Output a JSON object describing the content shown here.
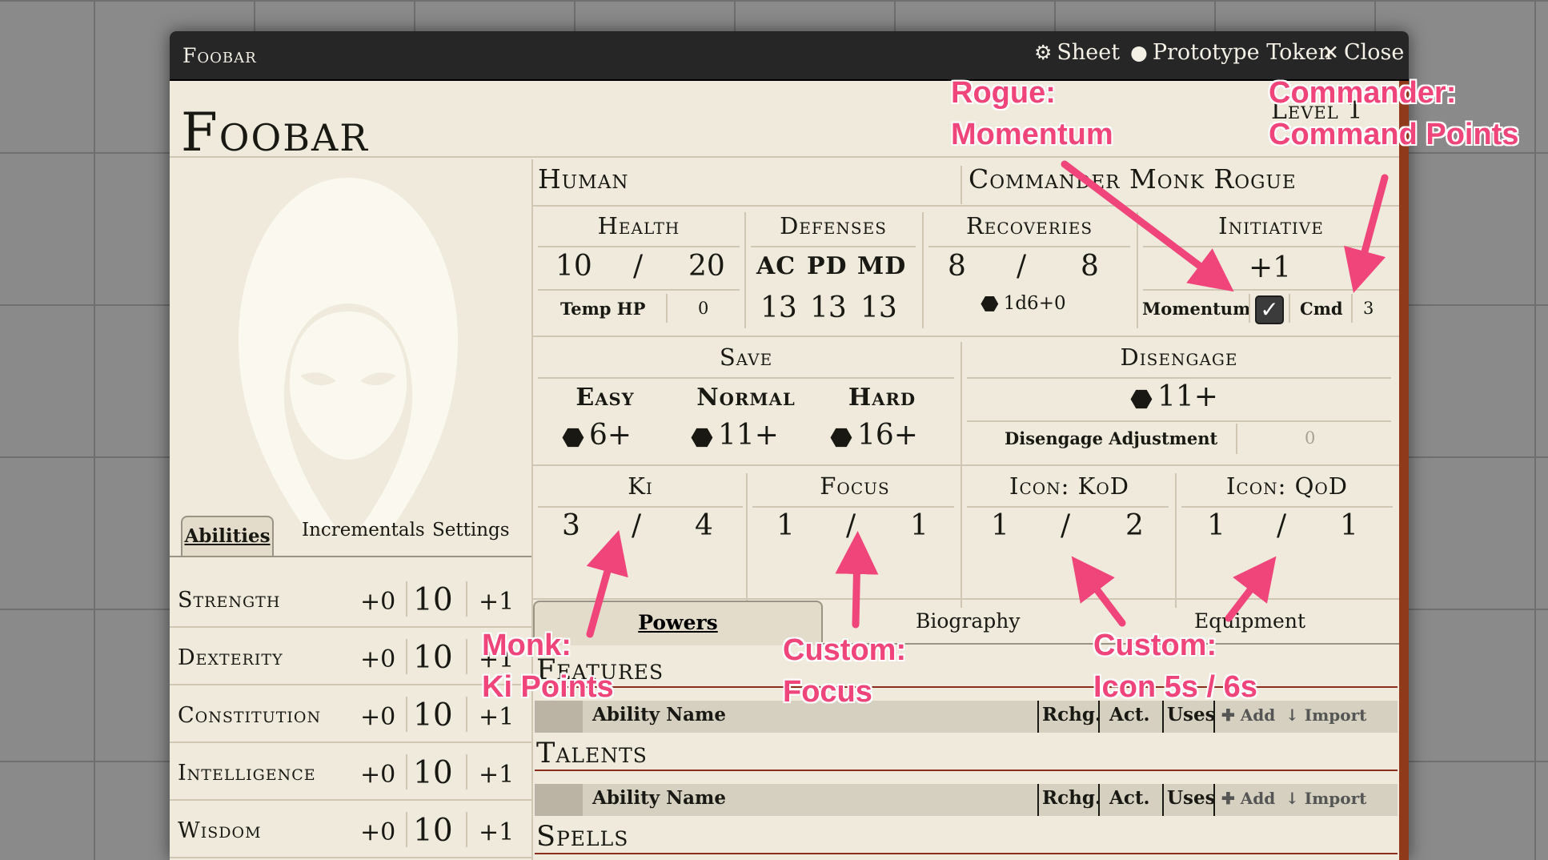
{
  "window": {
    "title": "Foobar",
    "buttons": {
      "sheet": "Sheet",
      "token": "Prototype Token",
      "close": "Close"
    }
  },
  "header": {
    "name": "Foobar",
    "level": "Level 1",
    "race": "Human",
    "classes": "Commander Monk Rogue"
  },
  "tabs": {
    "abilities": "Abilities",
    "incrementals": "Incrementals",
    "settings": "Settings"
  },
  "abilities": [
    {
      "name": "Strength",
      "mod": "+0",
      "score": "10",
      "bonus": "+1"
    },
    {
      "name": "Dexterity",
      "mod": "+0",
      "score": "10",
      "bonus": "+1"
    },
    {
      "name": "Constitution",
      "mod": "+0",
      "score": "10",
      "bonus": "+1"
    },
    {
      "name": "Intelligence",
      "mod": "+0",
      "score": "10",
      "bonus": "+1"
    },
    {
      "name": "Wisdom",
      "mod": "+0",
      "score": "10",
      "bonus": "+1"
    }
  ],
  "health": {
    "label": "Health",
    "current": "10",
    "sep": "/",
    "max": "20",
    "temp_label": "Temp HP",
    "temp": "0"
  },
  "defenses": {
    "label": "Defenses",
    "ac_label": "AC",
    "pd_label": "PD",
    "md_label": "MD",
    "ac": "13",
    "pd": "13",
    "md": "13"
  },
  "recoveries": {
    "label": "Recoveries",
    "current": "8",
    "sep": "/",
    "max": "8",
    "dice": "1d6+0"
  },
  "initiative": {
    "label": "Initiative",
    "value": "+1",
    "momentum_label": "Momentum",
    "momentum_checked": true,
    "cmd_label": "Cmd",
    "cmd": "3"
  },
  "save": {
    "label": "Save",
    "easy_label": "Easy",
    "easy": "6+",
    "normal_label": "Normal",
    "normal": "11+",
    "hard_label": "Hard",
    "hard": "16+"
  },
  "disengage": {
    "label": "Disengage",
    "value": "11+",
    "adj_label": "Disengage Adjustment",
    "adj": "0"
  },
  "resources": [
    {
      "label": "Ki",
      "current": "3",
      "sep": "/",
      "max": "4"
    },
    {
      "label": "Focus",
      "current": "1",
      "sep": "/",
      "max": "1"
    },
    {
      "label": "Icon: KoD",
      "current": "1",
      "sep": "/",
      "max": "2"
    },
    {
      "label": "Icon: QoD",
      "current": "1",
      "sep": "/",
      "max": "1"
    }
  ],
  "main_tabs": {
    "powers": "Powers",
    "biography": "Biography",
    "equipment": "Equipment"
  },
  "sections": {
    "features": "Features",
    "talents": "Talents",
    "spells": "Spells",
    "cols": {
      "name": "Ability Name",
      "rchg": "Rchg.",
      "act": "Act.",
      "uses": "Uses",
      "add": "Add",
      "import": "Import"
    }
  },
  "annotations": {
    "rogue_1": "Rogue:",
    "rogue_2": "Momentum",
    "commander_1": "Commander:",
    "commander_2": "Command Points",
    "monk_1": "Monk:",
    "monk_2": "Ki Points",
    "focus_1": "Custom:",
    "focus_2": "Focus",
    "icon_1": "Custom:",
    "icon_2": "Icon 5s / 6s"
  },
  "colors": {
    "parchment": "#efeadc",
    "titlebar": "#262626",
    "annotation": "#f0457b",
    "accent_red": "#8a2d1e"
  }
}
